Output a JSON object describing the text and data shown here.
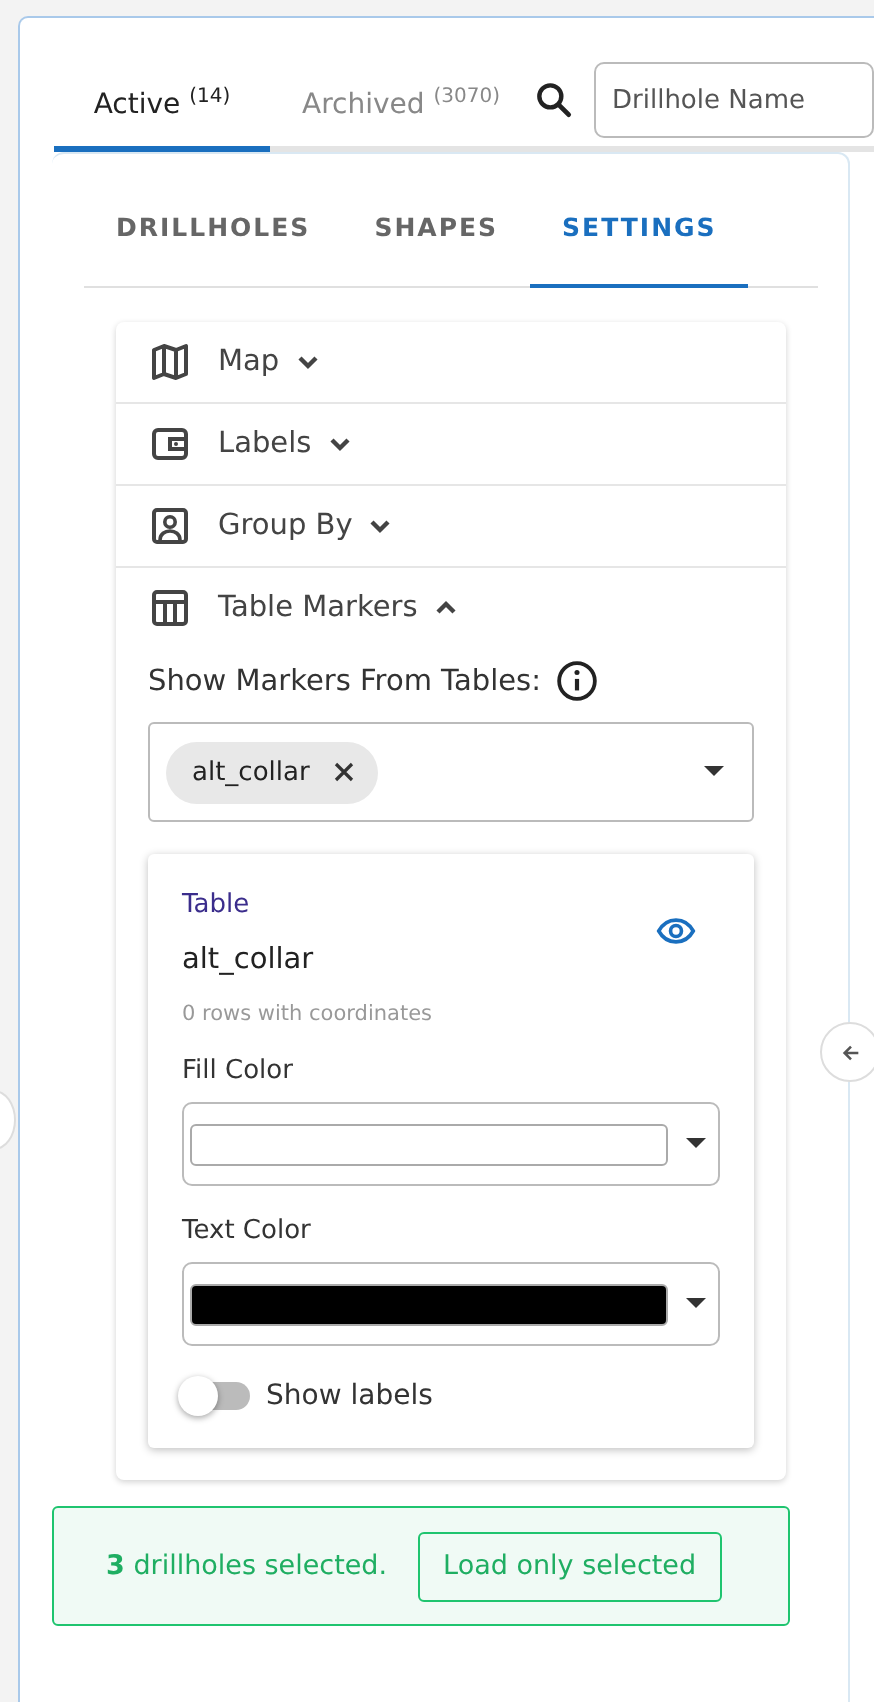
{
  "tabs": [
    {
      "label": "Active",
      "count": "(14)",
      "selected": true
    },
    {
      "label": "Archived",
      "count": "(3070)",
      "selected": false
    }
  ],
  "search": {
    "placeholder": "Drillhole Name"
  },
  "sub_tabs": [
    {
      "label": "DRILLHOLES",
      "selected": false
    },
    {
      "label": "SHAPES",
      "selected": false
    },
    {
      "label": "SETTINGS",
      "selected": true
    }
  ],
  "sections": [
    {
      "label": "Map",
      "expanded": false
    },
    {
      "label": "Labels",
      "expanded": false
    },
    {
      "label": "Group By",
      "expanded": false
    },
    {
      "label": "Table Markers",
      "expanded": true
    }
  ],
  "table_markers": {
    "label": "Show Markers From Tables:",
    "chips": [
      "alt_collar"
    ],
    "table_card": {
      "heading": "Table",
      "name": "alt_collar",
      "note": "0 rows with coordinates",
      "fill_color": {
        "label": "Fill Color",
        "color": "#ffffff"
      },
      "text_color": {
        "label": "Text Color",
        "color": "#000000"
      },
      "show_labels": {
        "label": "Show labels",
        "on": false
      }
    }
  },
  "banner": {
    "message": "**3**  drillholes selected.",
    "button": "Load only selected"
  }
}
